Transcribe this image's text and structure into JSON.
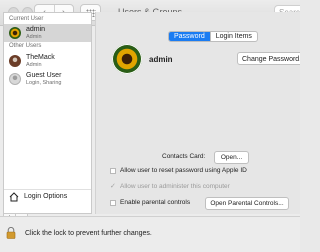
{
  "window": {
    "title": "Users & Groups",
    "search_placeholder": "Search"
  },
  "sidebar": {
    "current_user_label": "Current User",
    "current_user": {
      "name": "admin",
      "role": "Admin"
    },
    "other_users_label": "Other Users",
    "other_users": [
      {
        "name": "TheMack",
        "role": "Admin"
      },
      {
        "name": "Guest User",
        "role": "Login, Sharing"
      }
    ],
    "login_options_label": "Login Options",
    "add_label": "+",
    "remove_label": "−"
  },
  "main": {
    "tabs": [
      {
        "label": "Password",
        "active": true
      },
      {
        "label": "Login Items",
        "active": false
      }
    ],
    "profile_name": "admin",
    "change_password_label": "Change Password...",
    "contacts_card_label": "Contacts Card:",
    "open_button_label": "Open...",
    "allow_reset_label": "Allow user to reset password using Apple ID",
    "allow_admin_label": "Allow user to administer this computer",
    "parental_controls_label": "Enable parental controls",
    "open_parental_controls_label": "Open Parental Controls..."
  },
  "footer": {
    "lock_text": "Click the lock to prevent further changes."
  },
  "colors": {
    "accent": "#1b7cf2",
    "window_bg": "#ececec",
    "panel_bg": "#e6e6e6"
  },
  "icons": {
    "window_back": "chevron-left-icon",
    "window_forward": "chevron-right-icon",
    "show_all": "grid-icon",
    "login_options": "house-icon",
    "lock": "lock-icon"
  }
}
